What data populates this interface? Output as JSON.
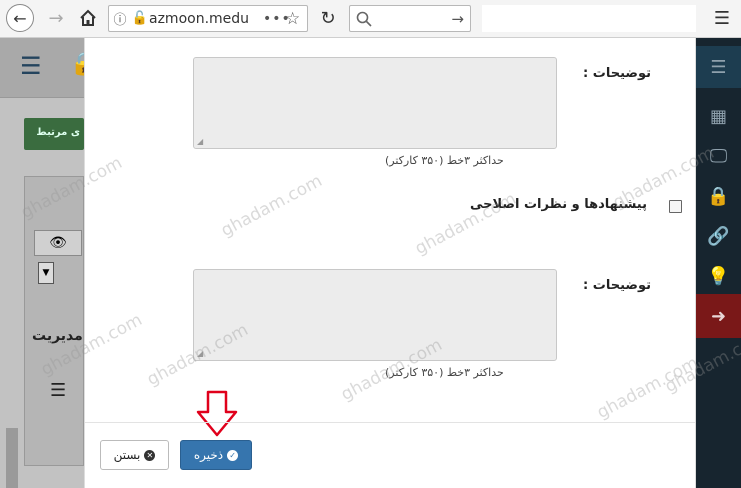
{
  "browser": {
    "url": "azmoon.medu",
    "icons": {
      "back": "arrow-left-icon",
      "forward": "arrow-right-icon",
      "home": "home-icon",
      "reload": "reload-icon",
      "menu": "hamburger-menu-icon"
    }
  },
  "background": {
    "green_button": "ی مرتبط",
    "admin_text": "مدیریت"
  },
  "modal": {
    "field1": {
      "label": "توضیحات :",
      "hint": "حداکثر ۳خط (۳۵۰ کارکتر)",
      "value": ""
    },
    "checkbox": {
      "label": "پیشنهادها و نظرات اصلاحی",
      "checked": false
    },
    "field2": {
      "label": "توضیحات :",
      "hint": "حداکثر ۳خط (۳۵۰ کارکتر)",
      "value": ""
    },
    "footer": {
      "close_label": "بستن",
      "save_label": "ذخیره"
    }
  },
  "watermark": "ghadam.com",
  "colors": {
    "save_button": "#3675ae",
    "sidebar_bg": "#17252f",
    "sidebar_active": "#7a1818",
    "arrow": "#e0001b"
  }
}
